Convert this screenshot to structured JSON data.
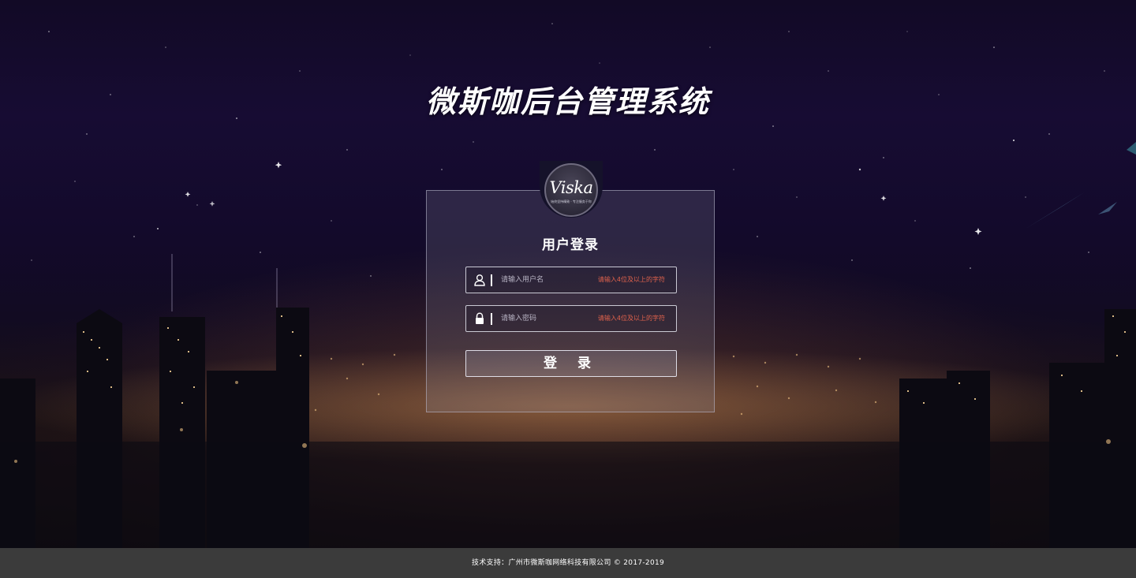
{
  "header": {
    "system_title": "微斯咖后台管理系统"
  },
  "logo": {
    "word": "Viska",
    "small_mark": "微斯咖",
    "tagline": "始终坚持精致 · 专注服务于你"
  },
  "login": {
    "title": "用户登录",
    "username": {
      "icon": "user-icon",
      "placeholder": "请输入用户名",
      "value": "",
      "hint": "请输入4位及以上的字符"
    },
    "password": {
      "icon": "lock-icon",
      "placeholder": "请输入密码",
      "value": "",
      "hint": "请输入4位及以上的字符"
    },
    "submit_label": "登 录"
  },
  "footer": {
    "text": "技术支持：广州市微斯咖网络科技有限公司 © 2017-2019"
  },
  "colors": {
    "hint": "#e0624c",
    "footer_bg": "#3b3b3b",
    "sky": "#170c33"
  }
}
